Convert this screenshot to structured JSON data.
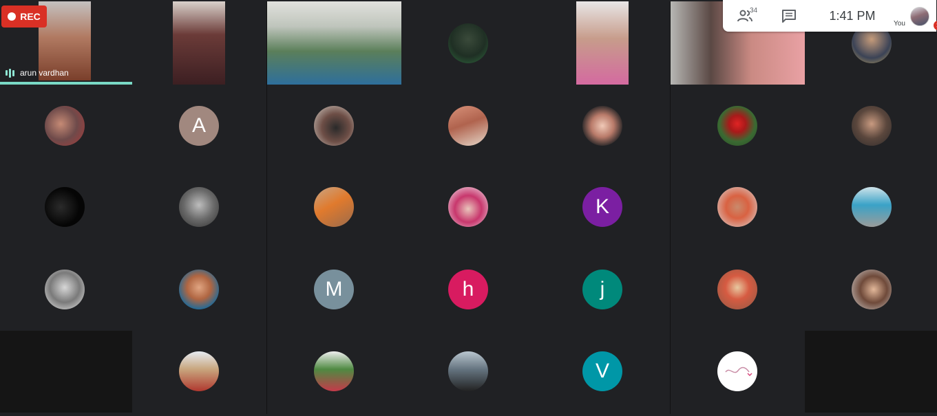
{
  "recording": {
    "label": "REC"
  },
  "toolbar": {
    "participant_count": "34",
    "time": "1:41 PM",
    "self_label": "You"
  },
  "speaker": {
    "name": "arun vardhan"
  },
  "avatars": {
    "a": "A",
    "k": "K",
    "m": "M",
    "h": "h",
    "j": "j",
    "v": "V"
  },
  "colors": {
    "background": "#202124",
    "empty_tile": "#151515",
    "rec": "#d93025",
    "speaking": "#7ad9c6",
    "avatar_a": "#a1887f",
    "avatar_k": "#7b1fa2",
    "avatar_m": "#78909c",
    "avatar_h": "#d81b60",
    "avatar_j": "#00897b",
    "avatar_v": "#0097a7"
  }
}
